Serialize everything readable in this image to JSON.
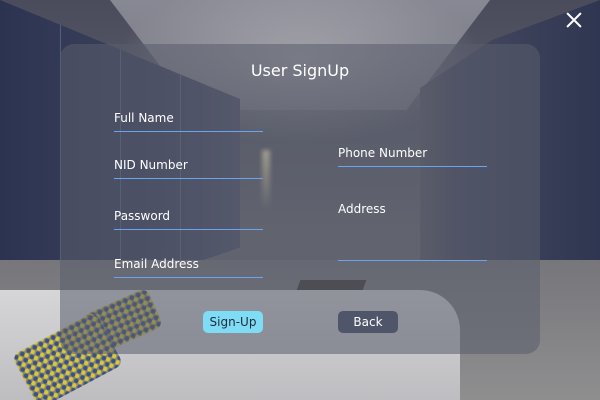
{
  "dialog": {
    "title": "User SignUp",
    "close_icon": "close-icon"
  },
  "fields": {
    "full_name": {
      "label": "Full Name",
      "value": ""
    },
    "nid_number": {
      "label": "NID Number",
      "value": ""
    },
    "password": {
      "label": "Password",
      "value": ""
    },
    "email_address": {
      "label": "Email Address",
      "value": ""
    },
    "phone_number": {
      "label": "Phone Number",
      "value": ""
    },
    "address": {
      "label": "Address",
      "value": ""
    }
  },
  "buttons": {
    "signup_label": "Sign-Up",
    "back_label": "Back"
  },
  "colors": {
    "accent": "#7fdcf5",
    "underline": "#6aa3f0",
    "secondary_button": "#4f5669"
  }
}
